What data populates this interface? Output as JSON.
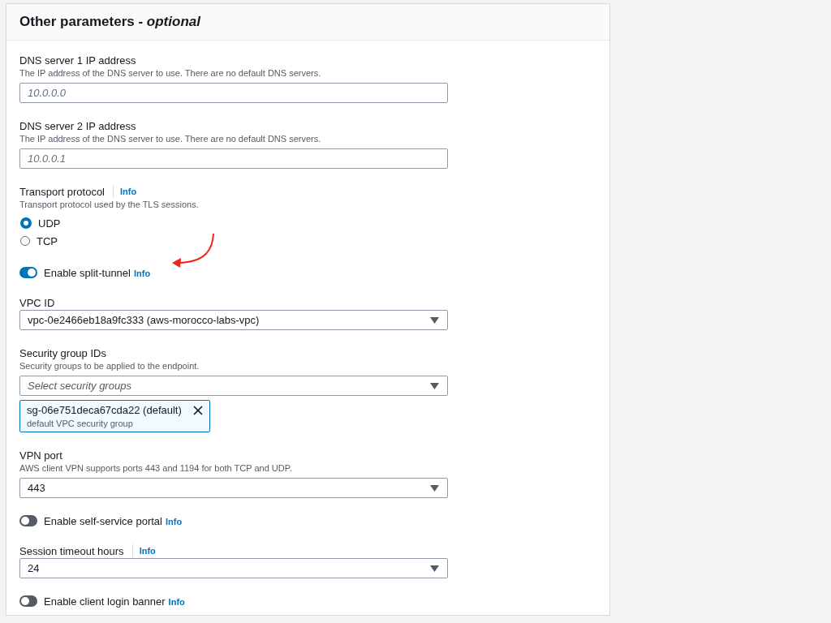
{
  "panel": {
    "title": "Other parameters - *optional*"
  },
  "fields": [
    {
      "kind": "text",
      "label": "DNS server 1 IP address",
      "description": "The IP address of the DNS server to use. There are no default DNS servers.",
      "placeholder": "10.0.0.0"
    },
    {
      "kind": "text",
      "label": "DNS server 2 IP address",
      "description": "The IP address of the DNS server to use. There are no default DNS servers.",
      "placeholder": "10.0.0.1"
    },
    {
      "kind": "radio",
      "label": "Transport protocol",
      "info": "Info",
      "description": "Transport protocol used by the TLS sessions.",
      "options": [
        {
          "label": "UDP",
          "selected": true
        },
        {
          "label": "TCP",
          "selected": false
        }
      ]
    },
    {
      "kind": "toggle",
      "label": "Enable split-tunnel",
      "info": "Info",
      "on": true,
      "annotated": true
    },
    {
      "kind": "select",
      "label": "VPC ID",
      "value": "vpc-0e2466eb18a9fc333 (aws-morocco-labs-vpc)"
    },
    {
      "kind": "multiselect",
      "label": "Security group IDs",
      "description": "Security groups to be applied to the endpoint.",
      "placeholder": "Select security groups",
      "tokens": [
        {
          "label": "sg-06e751deca67cda22 (default)",
          "description": "default VPC security group"
        }
      ]
    },
    {
      "kind": "select",
      "label": "VPN port",
      "description": "AWS client VPN supports ports 443 and 1194 for both TCP and UDP.",
      "value": "443"
    },
    {
      "kind": "toggle",
      "label": "Enable self-service portal",
      "info": "Info",
      "on": false,
      "annotated": false
    },
    {
      "kind": "select",
      "label": "Session timeout hours",
      "info": "Info",
      "value": "24"
    },
    {
      "kind": "toggle",
      "label": "Enable client login banner",
      "info": "Info",
      "on": false,
      "annotated": false
    }
  ]
}
